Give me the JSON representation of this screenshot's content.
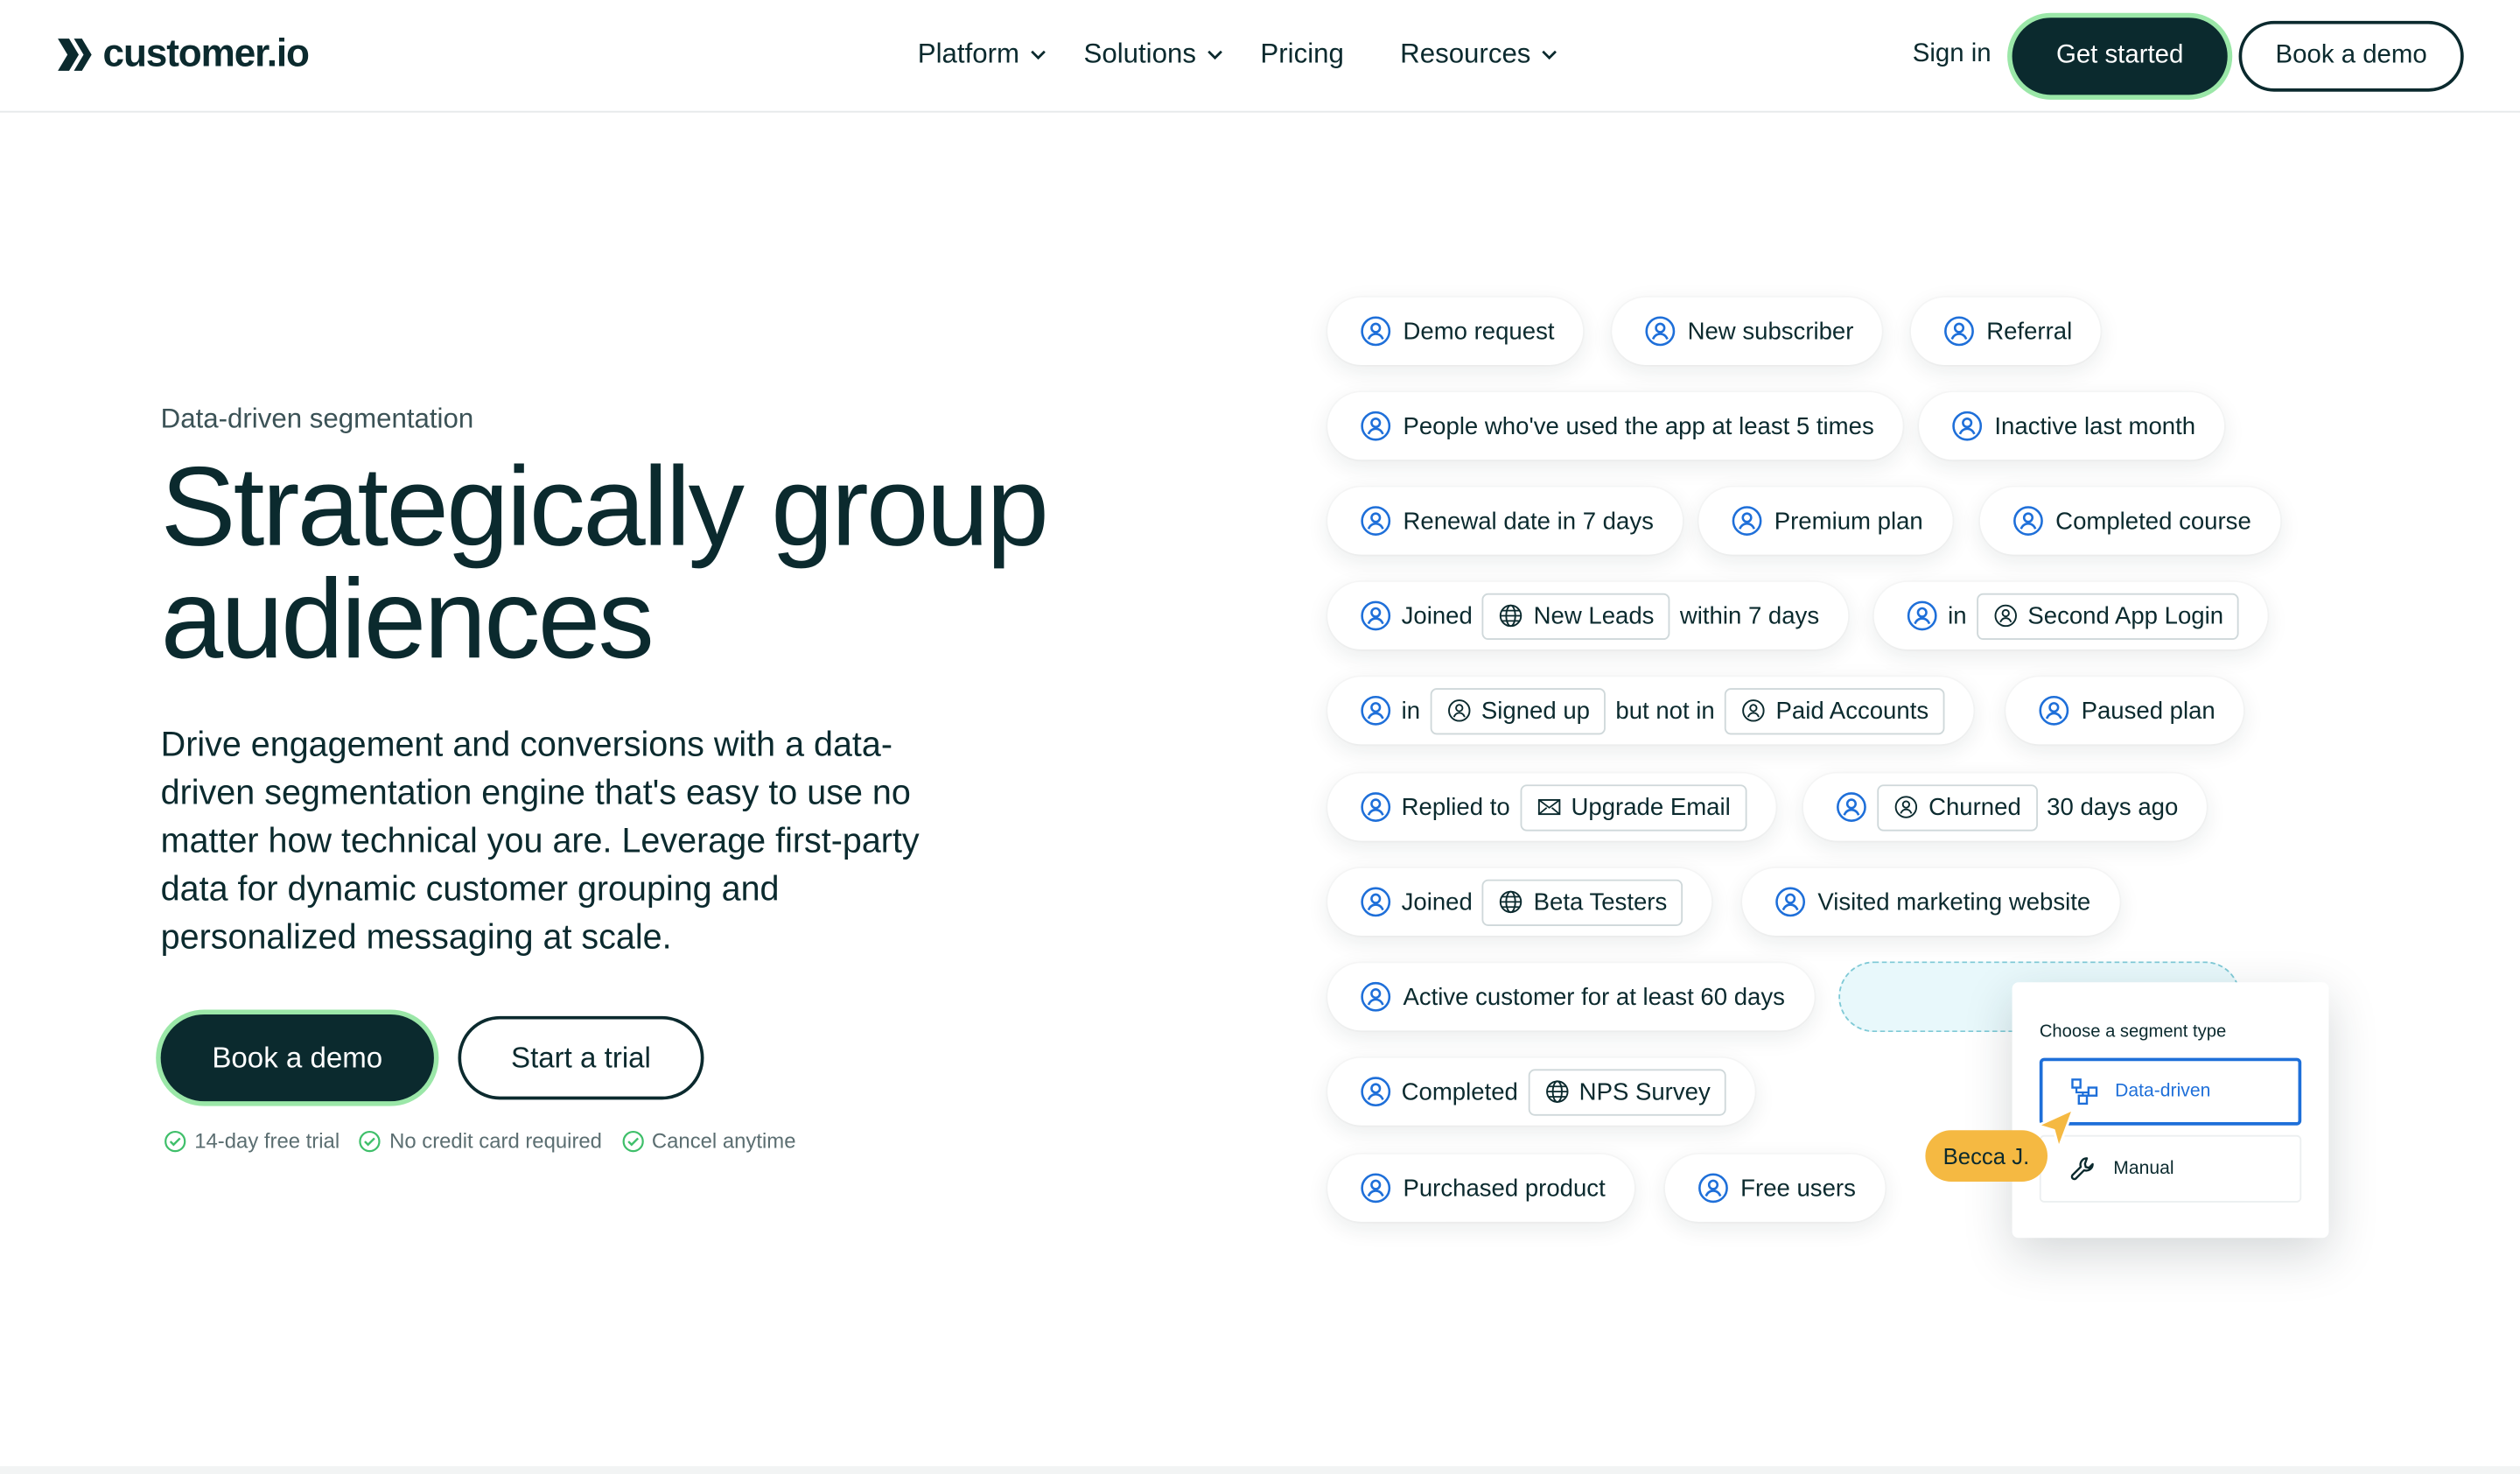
{
  "nav": {
    "logo_text": "customer.io",
    "links": [
      {
        "label": "Platform",
        "has_dropdown": true
      },
      {
        "label": "Solutions",
        "has_dropdown": true
      },
      {
        "label": "Pricing",
        "has_dropdown": false
      },
      {
        "label": "Resources",
        "has_dropdown": true
      }
    ],
    "sign_in": "Sign in",
    "get_started": "Get started",
    "book_demo": "Book a demo"
  },
  "hero": {
    "eyebrow": "Data-driven segmentation",
    "title_line1": "Strategically group",
    "title_line2": "audiences",
    "description": "Drive engagement and conversions with a data-driven segmentation engine that's easy to use no matter how technical you are. Leverage first-party data for dynamic customer grouping and personalized messaging at scale.",
    "cta_primary": "Book a demo",
    "cta_secondary": "Start a trial",
    "benefits": [
      "14-day free trial",
      "No credit card required",
      "Cancel anytime"
    ]
  },
  "segments": {
    "demo_request": "Demo request",
    "new_subscriber": "New subscriber",
    "referral": "Referral",
    "used_app": "People who've used the app at least 5 times",
    "inactive": "Inactive last month",
    "renewal": "Renewal date in 7 days",
    "premium": "Premium plan",
    "completed_course": "Completed course",
    "joined_new_leads": {
      "pre": "Joined",
      "tag": "New Leads",
      "post": "within 7 days"
    },
    "in_second_login": {
      "pre": "in",
      "tag": "Second App Login"
    },
    "signed_up_not_paid": {
      "pre": "in",
      "tag1": "Signed up",
      "mid": "but not in",
      "tag2": "Paid Accounts"
    },
    "paused": "Paused plan",
    "replied_upgrade": {
      "pre": "Replied to",
      "tag": "Upgrade Email"
    },
    "churned": {
      "tag": "Churned",
      "post": "30 days ago"
    },
    "joined_beta": {
      "pre": "Joined",
      "tag": "Beta Testers"
    },
    "visited": "Visited marketing website",
    "active_60": "Active customer for at least 60 days",
    "completed_nps": {
      "pre": "Completed",
      "tag": "NPS Survey"
    },
    "purchased": "Purchased product",
    "free_users": "Free users"
  },
  "segment_card": {
    "title": "Choose a segment type",
    "option_selected": "Data-driven",
    "option_other": "Manual"
  },
  "cursor_label": "Becca J.",
  "colors": {
    "brand_dark": "#0b2a2e",
    "accent_green": "#9be7a8",
    "icon_blue": "#1e6fd9",
    "tag_yellow": "#f5b942"
  }
}
